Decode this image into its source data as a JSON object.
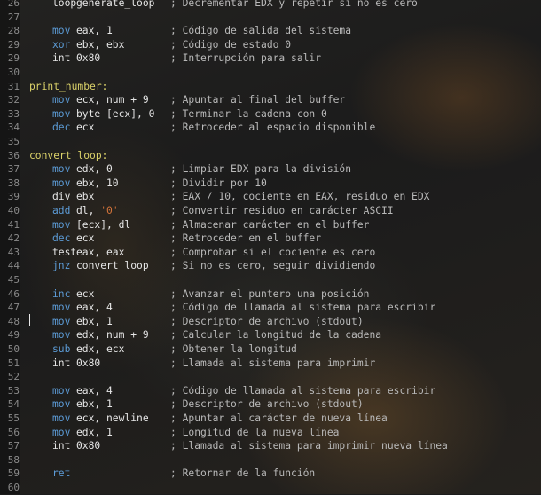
{
  "editor": {
    "lines": [
      {
        "n": "26",
        "i": "loop",
        "iclass": "kw-white",
        "o": "generate_loop",
        "c": "; Decrementar EDX y repetir si no es cero"
      },
      {
        "n": "27"
      },
      {
        "n": "28",
        "i": "mov",
        "iclass": "kw-blue",
        "o": "eax, 1",
        "c": "; Código de salida del sistema"
      },
      {
        "n": "29",
        "i": "xor",
        "iclass": "kw-blue",
        "o": "ebx, ebx",
        "c": "; Código de estado 0"
      },
      {
        "n": "29",
        "i": "int",
        "iclass": "kw-white",
        "o": "0x80",
        "c": "; Interrupción para salir"
      },
      {
        "n": "30"
      },
      {
        "n": "31",
        "l": "print_number:"
      },
      {
        "n": "32",
        "i": "mov",
        "iclass": "kw-blue",
        "o": "ecx, num + 9",
        "c": "; Apuntar al final del buffer"
      },
      {
        "n": "33",
        "i": "mov",
        "iclass": "kw-blue",
        "o": "byte [ecx], 0",
        "c": "; Terminar la cadena con 0"
      },
      {
        "n": "34",
        "i": "dec",
        "iclass": "kw-blue",
        "o": "ecx",
        "c": "; Retroceder al espacio disponible"
      },
      {
        "n": "35"
      },
      {
        "n": "36",
        "l": "convert_loop:"
      },
      {
        "n": "37",
        "i": "mov",
        "iclass": "kw-blue",
        "o": "edx, 0",
        "c": "; Limpiar EDX para la división"
      },
      {
        "n": "38",
        "i": "mov",
        "iclass": "kw-blue",
        "o": "ebx, 10",
        "c": "; Dividir por 10"
      },
      {
        "n": "39",
        "i": "div",
        "iclass": "kw-white",
        "o": "ebx",
        "c": "; EAX / 10, cociente en EAX, residuo en EDX"
      },
      {
        "n": "40",
        "i": "add",
        "iclass": "kw-blue",
        "o": "dl, ",
        "s": "'0'",
        "c": "; Convertir residuo en carácter ASCII"
      },
      {
        "n": "41",
        "i": "mov",
        "iclass": "kw-blue",
        "o": "[ecx], dl",
        "c": "; Almacenar carácter en el buffer"
      },
      {
        "n": "42",
        "i": "dec",
        "iclass": "kw-blue",
        "o": "ecx",
        "c": "; Retroceder en el buffer"
      },
      {
        "n": "43",
        "i": "test",
        "iclass": "kw-white",
        "o": "eax, eax",
        "c": "; Comprobar si el cociente es cero"
      },
      {
        "n": "44",
        "i": "jnz",
        "iclass": "kw-blue",
        "o": "convert_loop",
        "c": "; Si no es cero, seguir dividiendo"
      },
      {
        "n": "45"
      },
      {
        "n": "46",
        "i": "inc",
        "iclass": "kw-blue",
        "o": "ecx",
        "c": "; Avanzar el puntero una posición"
      },
      {
        "n": "47",
        "i": "mov",
        "iclass": "kw-blue",
        "o": "eax, 4",
        "c": "; Código de llamada al sistema para escribir"
      },
      {
        "n": "48",
        "i": "mov",
        "iclass": "kw-blue",
        "o": "ebx, 1",
        "c": "; Descriptor de archivo (stdout)"
      },
      {
        "n": "49",
        "i": "mov",
        "iclass": "kw-blue",
        "o": "edx, num + 9",
        "c": "; Calcular la longitud de la cadena"
      },
      {
        "n": "50",
        "i": "sub",
        "iclass": "kw-blue",
        "o": "edx, ecx",
        "c": "; Obtener la longitud"
      },
      {
        "n": "51",
        "i": "int",
        "iclass": "kw-white",
        "o": "0x80",
        "c": "; Llamada al sistema para imprimir"
      },
      {
        "n": "52"
      },
      {
        "n": "53",
        "i": "mov",
        "iclass": "kw-blue",
        "o": "eax, 4",
        "c": "; Código de llamada al sistema para escribir"
      },
      {
        "n": "54",
        "i": "mov",
        "iclass": "kw-blue",
        "o": "ebx, 1",
        "c": "; Descriptor de archivo (stdout)"
      },
      {
        "n": "55",
        "i": "mov",
        "iclass": "kw-blue",
        "o": "ecx, newline",
        "c": "; Apuntar al carácter de nueva línea"
      },
      {
        "n": "56",
        "i": "mov",
        "iclass": "kw-blue",
        "o": "edx, 1",
        "c": "; Longitud de la nueva línea"
      },
      {
        "n": "57",
        "i": "int",
        "iclass": "kw-white",
        "o": "0x80",
        "c": "; Llamada al sistema para imprimir nueva línea"
      },
      {
        "n": "58"
      },
      {
        "n": "59",
        "i": "ret",
        "iclass": "kw-blue",
        "o": "",
        "c": "; Retornar de la función"
      },
      {
        "n": "60"
      }
    ]
  },
  "colors": {
    "keyword_blue": "#5c9bd6",
    "label_yellow": "#dcd36a",
    "string_orange": "#d2733a",
    "comment_gray": "#b9b9b9",
    "line_number_gray": "#8a8a8a"
  }
}
